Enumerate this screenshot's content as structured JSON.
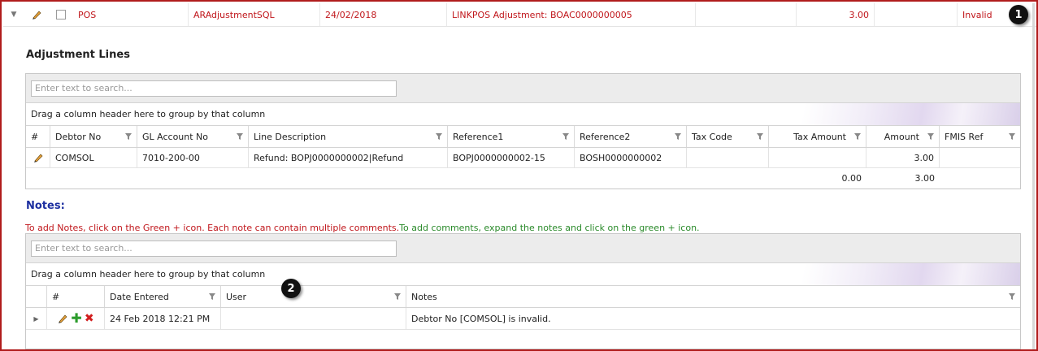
{
  "master_row": {
    "expander_icon": "triangle-down-icon",
    "source": "POS",
    "sql_name": "ARAdjustmentSQL",
    "date": "24/02/2018",
    "description": "LINKPOS Adjustment: BOAC0000000005",
    "empty1": "",
    "amount": "3.00",
    "empty2": "",
    "status": "Invalid",
    "callout": "1"
  },
  "adjustment_lines": {
    "title": "Adjustment Lines",
    "search_placeholder": "Enter text to search...",
    "group_hint": "Drag a column header here to group by that column",
    "columns": [
      "#",
      "Debtor No",
      "GL Account No",
      "Line Description",
      "Reference1",
      "Reference2",
      "Tax Code",
      "Tax Amount",
      "Amount",
      "FMIS Ref"
    ],
    "rows": [
      {
        "debtor_no": "COMSOL",
        "gl_account_no": "7010-200-00",
        "line_description": "Refund: BOPJ0000000002|Refund",
        "reference1": "BOPJ0000000002-15",
        "reference2": "BOSH0000000002",
        "tax_code": "",
        "tax_amount": "",
        "amount": "3.00",
        "fmis_ref": ""
      }
    ],
    "totals": {
      "tax_amount": "0.00",
      "amount": "3.00"
    }
  },
  "notes": {
    "title": "Notes:",
    "instruction_red": "To add Notes, click on the Green + icon. Each note can contain multiple comments.",
    "instruction_green": "To add comments, expand the notes and click on the green + icon.",
    "search_placeholder": "Enter text to search...",
    "group_hint": "Drag a column header here to group by that column",
    "columns": [
      "#",
      "Date Entered",
      "User",
      "Notes"
    ],
    "callout": "2",
    "rows": [
      {
        "date_entered": "24 Feb 2018 12:21 PM",
        "user": "",
        "notes": "Debtor No [COMSOL] is invalid."
      }
    ]
  },
  "colors": {
    "frame_border": "#b01c1c",
    "master_text": "#c0161b",
    "notes_title": "#1d2fa0",
    "instruction_green": "#2a8a2a"
  }
}
